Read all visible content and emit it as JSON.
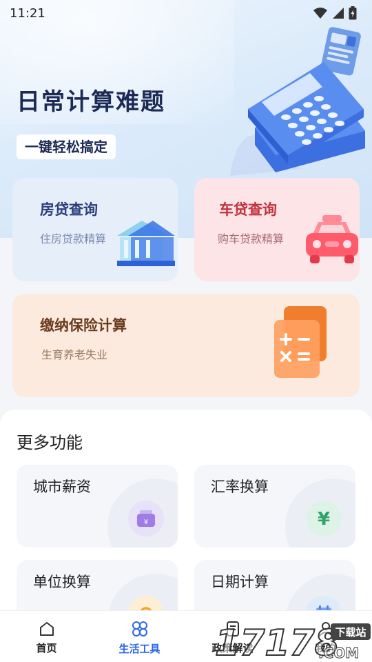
{
  "status_bar": {
    "time": "11:21"
  },
  "hero": {
    "title": "日常计算难题",
    "subtitle": "一键轻松搞定"
  },
  "cards": {
    "house": {
      "title": "房贷查询",
      "desc": "住房贷款精算"
    },
    "car": {
      "title": "车贷查询",
      "desc": "购车贷款精算"
    },
    "insurance": {
      "title": "缴纳保险计算",
      "desc": "生育养老失业"
    }
  },
  "more": {
    "title": "更多功能",
    "tiles": [
      {
        "label": "城市薪资",
        "icon": "wallet-icon",
        "icon_symbol": "¥"
      },
      {
        "label": "汇率换算",
        "icon": "yuan-icon",
        "icon_symbol": "¥"
      },
      {
        "label": "单位换算",
        "icon": "refresh-icon"
      },
      {
        "label": "日期计算",
        "icon": "calendar-icon"
      }
    ]
  },
  "tabs": [
    {
      "label": "首页",
      "icon": "home-icon",
      "active": false
    },
    {
      "label": "生活工具",
      "icon": "clover-icon",
      "active": true
    },
    {
      "label": "政策解读",
      "icon": "document-icon",
      "active": false
    },
    {
      "label": "我的",
      "icon": "user-icon",
      "active": false
    }
  ],
  "watermark": {
    "text": "17178",
    "suffix": ".COM",
    "badge": "下载站"
  },
  "colors": {
    "accent": "#2a66e8",
    "house_title": "#2a3f7a",
    "car_title": "#c2323d",
    "insurance_title": "#6b3b1f"
  }
}
